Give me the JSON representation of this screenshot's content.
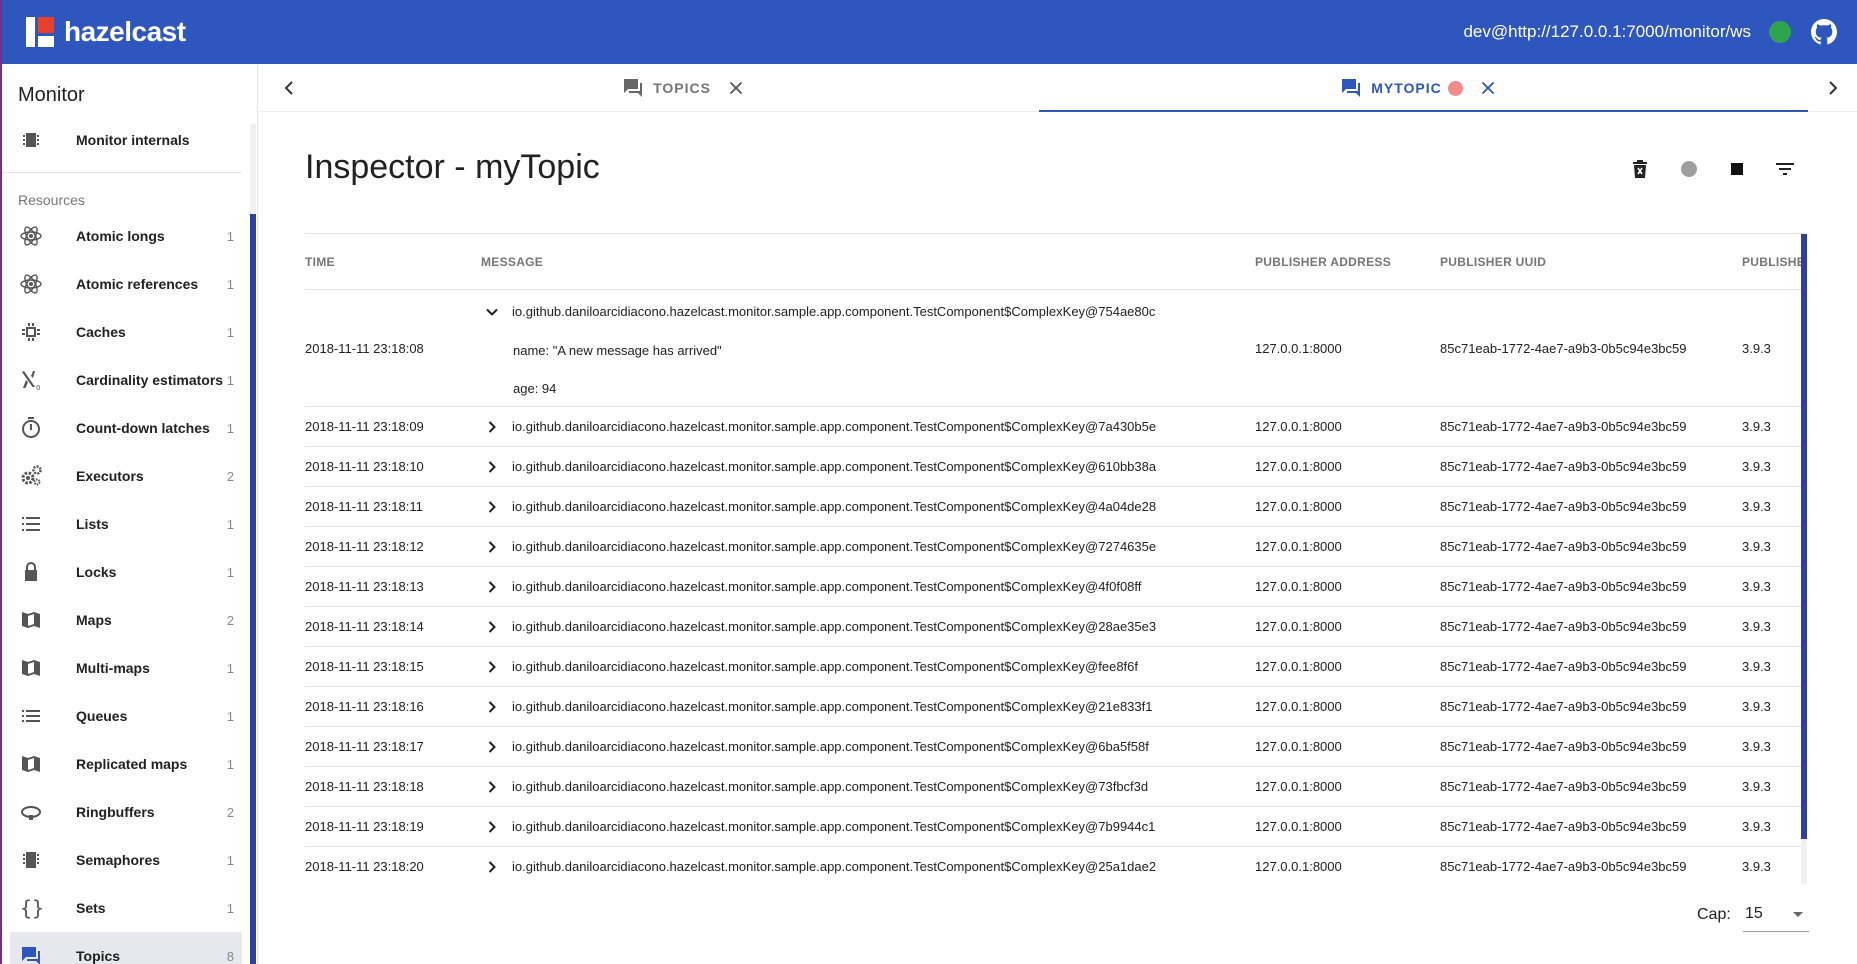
{
  "header": {
    "brand": "hazelcast",
    "connection": "dev@http://127.0.0.1:7000/monitor/ws",
    "status_color": "#2ea44f"
  },
  "sidebar": {
    "title": "Monitor",
    "top_item": {
      "label": "Monitor internals",
      "icon": "chip-icon"
    },
    "section_label": "Resources",
    "items": [
      {
        "label": "Atomic longs",
        "count": "1",
        "icon": "atom-icon"
      },
      {
        "label": "Atomic references",
        "count": "1",
        "icon": "atom-icon"
      },
      {
        "label": "Caches",
        "count": "1",
        "icon": "memory-icon"
      },
      {
        "label": "Cardinality estimators",
        "count": "1",
        "icon": "aleph-icon"
      },
      {
        "label": "Count-down latches",
        "count": "1",
        "icon": "timer-icon"
      },
      {
        "label": "Executors",
        "count": "2",
        "icon": "gears-icon"
      },
      {
        "label": "Lists",
        "count": "1",
        "icon": "list-icon"
      },
      {
        "label": "Locks",
        "count": "1",
        "icon": "lock-icon"
      },
      {
        "label": "Maps",
        "count": "2",
        "icon": "map-icon"
      },
      {
        "label": "Multi-maps",
        "count": "1",
        "icon": "map-icon"
      },
      {
        "label": "Queues",
        "count": "1",
        "icon": "queue-icon"
      },
      {
        "label": "Replicated maps",
        "count": "1",
        "icon": "map-icon"
      },
      {
        "label": "Ringbuffers",
        "count": "2",
        "icon": "ring-icon"
      },
      {
        "label": "Semaphores",
        "count": "1",
        "icon": "chip-icon"
      },
      {
        "label": "Sets",
        "count": "1",
        "icon": "braces-icon"
      },
      {
        "label": "Topics",
        "count": "8",
        "icon": "forum-icon"
      }
    ]
  },
  "tabs": [
    {
      "label": "TOPICS",
      "active": false
    },
    {
      "label": "MYTOPIC",
      "active": true
    }
  ],
  "inspector": {
    "title": "Inspector - myTopic",
    "columns": [
      "TIME",
      "MESSAGE",
      "PUBLISHER ADDRESS",
      "PUBLISHER UUID",
      "PUBLISHER"
    ],
    "expanded": {
      "time": "2018-11-11 23:18:08",
      "message": "io.github.daniloarcidiacono.hazelcast.monitor.sample.app.component.TestComponent$ComplexKey@754ae80c",
      "detail_name": "name: \"A new message has arrived\"",
      "detail_age": "age: 94",
      "address": "127.0.0.1:8000",
      "uuid": "85c71eab-1772-4ae7-a9b3-0b5c94e3bc59",
      "version": "3.9.3"
    },
    "rows": [
      {
        "time": "2018-11-11 23:18:09",
        "message": "io.github.daniloarcidiacono.hazelcast.monitor.sample.app.component.TestComponent$ComplexKey@7a430b5e",
        "address": "127.0.0.1:8000",
        "uuid": "85c71eab-1772-4ae7-a9b3-0b5c94e3bc59",
        "version": "3.9.3"
      },
      {
        "time": "2018-11-11 23:18:10",
        "message": "io.github.daniloarcidiacono.hazelcast.monitor.sample.app.component.TestComponent$ComplexKey@610bb38a",
        "address": "127.0.0.1:8000",
        "uuid": "85c71eab-1772-4ae7-a9b3-0b5c94e3bc59",
        "version": "3.9.3"
      },
      {
        "time": "2018-11-11 23:18:11",
        "message": "io.github.daniloarcidiacono.hazelcast.monitor.sample.app.component.TestComponent$ComplexKey@4a04de28",
        "address": "127.0.0.1:8000",
        "uuid": "85c71eab-1772-4ae7-a9b3-0b5c94e3bc59",
        "version": "3.9.3"
      },
      {
        "time": "2018-11-11 23:18:12",
        "message": "io.github.daniloarcidiacono.hazelcast.monitor.sample.app.component.TestComponent$ComplexKey@7274635e",
        "address": "127.0.0.1:8000",
        "uuid": "85c71eab-1772-4ae7-a9b3-0b5c94e3bc59",
        "version": "3.9.3"
      },
      {
        "time": "2018-11-11 23:18:13",
        "message": "io.github.daniloarcidiacono.hazelcast.monitor.sample.app.component.TestComponent$ComplexKey@4f0f08ff",
        "address": "127.0.0.1:8000",
        "uuid": "85c71eab-1772-4ae7-a9b3-0b5c94e3bc59",
        "version": "3.9.3"
      },
      {
        "time": "2018-11-11 23:18:14",
        "message": "io.github.daniloarcidiacono.hazelcast.monitor.sample.app.component.TestComponent$ComplexKey@28ae35e3",
        "address": "127.0.0.1:8000",
        "uuid": "85c71eab-1772-4ae7-a9b3-0b5c94e3bc59",
        "version": "3.9.3"
      },
      {
        "time": "2018-11-11 23:18:15",
        "message": "io.github.daniloarcidiacono.hazelcast.monitor.sample.app.component.TestComponent$ComplexKey@fee8f6f",
        "address": "127.0.0.1:8000",
        "uuid": "85c71eab-1772-4ae7-a9b3-0b5c94e3bc59",
        "version": "3.9.3"
      },
      {
        "time": "2018-11-11 23:18:16",
        "message": "io.github.daniloarcidiacono.hazelcast.monitor.sample.app.component.TestComponent$ComplexKey@21e833f1",
        "address": "127.0.0.1:8000",
        "uuid": "85c71eab-1772-4ae7-a9b3-0b5c94e3bc59",
        "version": "3.9.3"
      },
      {
        "time": "2018-11-11 23:18:17",
        "message": "io.github.daniloarcidiacono.hazelcast.monitor.sample.app.component.TestComponent$ComplexKey@6ba5f58f",
        "address": "127.0.0.1:8000",
        "uuid": "85c71eab-1772-4ae7-a9b3-0b5c94e3bc59",
        "version": "3.9.3"
      },
      {
        "time": "2018-11-11 23:18:18",
        "message": "io.github.daniloarcidiacono.hazelcast.monitor.sample.app.component.TestComponent$ComplexKey@73fbcf3d",
        "address": "127.0.0.1:8000",
        "uuid": "85c71eab-1772-4ae7-a9b3-0b5c94e3bc59",
        "version": "3.9.3"
      },
      {
        "time": "2018-11-11 23:18:19",
        "message": "io.github.daniloarcidiacono.hazelcast.monitor.sample.app.component.TestComponent$ComplexKey@7b9944c1",
        "address": "127.0.0.1:8000",
        "uuid": "85c71eab-1772-4ae7-a9b3-0b5c94e3bc59",
        "version": "3.9.3"
      },
      {
        "time": "2018-11-11 23:18:20",
        "message": "io.github.daniloarcidiacono.hazelcast.monitor.sample.app.component.TestComponent$ComplexKey@25a1dae2",
        "address": "127.0.0.1:8000",
        "uuid": "85c71eab-1772-4ae7-a9b3-0b5c94e3bc59",
        "version": "3.9.3"
      }
    ],
    "cap_label": "Cap:",
    "cap_value": "15"
  }
}
